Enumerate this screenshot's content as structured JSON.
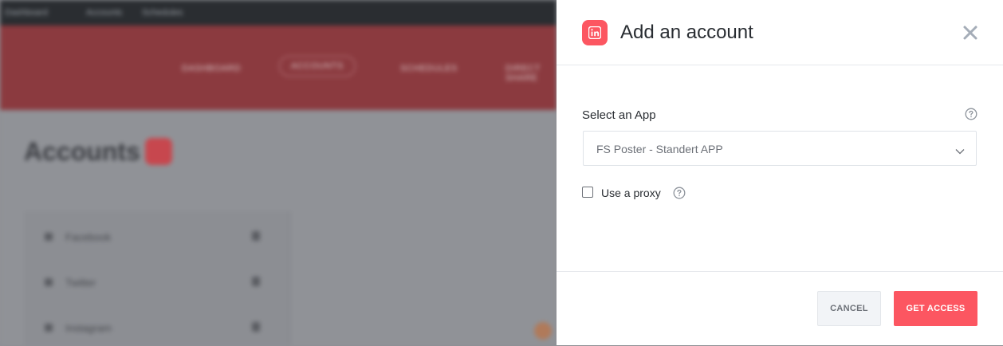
{
  "background": {
    "admin_bar": [
      "Dashboard",
      "Accounts",
      "Schedules"
    ],
    "nav": [
      "DASHBOARD",
      "ACCOUNTS",
      "SCHEDULES",
      "DIRECT SHARE"
    ],
    "page_title": "Accounts",
    "networks": [
      {
        "label": "Facebook"
      },
      {
        "label": "Twitter"
      },
      {
        "label": "Instagram"
      }
    ]
  },
  "drawer": {
    "title": "Add an account",
    "app_icon": "linkedin-icon",
    "select_label": "Select an App",
    "select_value": "FS Poster - Standert APP",
    "proxy_label": "Use a proxy",
    "cancel_label": "CANCEL",
    "access_label": "GET ACCESS",
    "accent_color": "#fc5661"
  }
}
